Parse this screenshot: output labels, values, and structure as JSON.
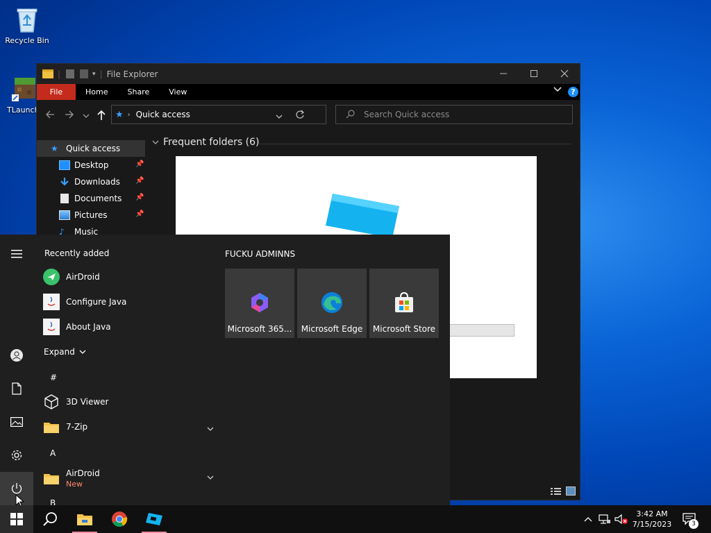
{
  "desktop": {
    "icons": [
      {
        "label": "Recycle Bin",
        "icon": "recycle-bin-icon"
      },
      {
        "label": "TLaunch",
        "icon": "tlauncher-icon"
      }
    ]
  },
  "explorer": {
    "title": "File Explorer",
    "ribbon_tabs": [
      "File",
      "Home",
      "Share",
      "View"
    ],
    "address": "Quick access",
    "search_placeholder": "Search Quick access",
    "section_title": "Frequent folders (6)",
    "nav": [
      {
        "label": "Quick access",
        "pinned": false
      },
      {
        "label": "Desktop",
        "pinned": true
      },
      {
        "label": "Downloads",
        "pinned": true
      },
      {
        "label": "Documents",
        "pinned": true
      },
      {
        "label": "Pictures",
        "pinned": true
      },
      {
        "label": "Music",
        "pinned": false
      }
    ]
  },
  "start_menu": {
    "recently_added_label": "Recently added",
    "recent_apps": [
      "AirDroid",
      "Configure Java",
      "About Java"
    ],
    "expand_label": "Expand",
    "letters": [
      "#",
      "A",
      "B"
    ],
    "apps": [
      {
        "label": "3D Viewer",
        "has_chevron": false
      },
      {
        "label": "7-Zip",
        "has_chevron": true
      },
      {
        "label": "AirDroid",
        "has_chevron": true,
        "badge": "New"
      }
    ],
    "tile_group_title": "FUCKU ADMINNS",
    "tiles": [
      "Microsoft 365...",
      "Microsoft Edge",
      "Microsoft Store"
    ]
  },
  "taskbar": {
    "time": "3:42 AM",
    "date": "7/15/2023",
    "notification_count": "3"
  },
  "colors": {
    "accent": "#0078d4",
    "file_tab": "#c42b1c",
    "new_badge": "#ff8a6b"
  }
}
